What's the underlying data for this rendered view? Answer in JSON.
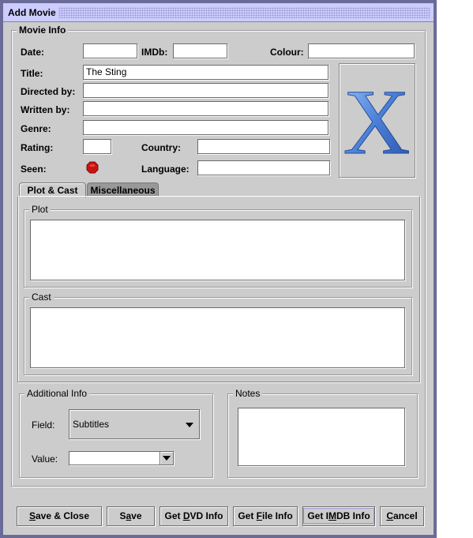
{
  "window": {
    "title": "Add Movie"
  },
  "movie_info": {
    "legend": "Movie Info",
    "date": {
      "label": "Date:",
      "value": ""
    },
    "imdb": {
      "label": "IMDb:",
      "value": ""
    },
    "colour": {
      "label": "Colour:",
      "value": ""
    },
    "title": {
      "label": "Title:",
      "value": "The Sting"
    },
    "directed_by": {
      "label": "Directed by:",
      "value": ""
    },
    "written_by": {
      "label": "Written by:",
      "value": ""
    },
    "genre": {
      "label": "Genre:",
      "value": ""
    },
    "rating": {
      "label": "Rating:",
      "value": ""
    },
    "country": {
      "label": "Country:",
      "value": ""
    },
    "seen": {
      "label": "Seen:",
      "state": "not-seen",
      "indicator_color": "#cc1111"
    },
    "language": {
      "label": "Language:",
      "value": ""
    },
    "cover": {
      "icon": "x-logo-icon",
      "glyph": "X",
      "color": "#4a7fd6"
    }
  },
  "tabs": [
    {
      "label": "Plot & Cast",
      "active": true
    },
    {
      "label": "Miscellaneous",
      "active": false
    }
  ],
  "plot": {
    "legend": "Plot",
    "value": ""
  },
  "cast": {
    "legend": "Cast",
    "value": ""
  },
  "additional_info": {
    "legend": "Additional Info",
    "field": {
      "label": "Field:",
      "selected": "Subtitles"
    },
    "value": {
      "label": "Value:",
      "selected": ""
    }
  },
  "notes": {
    "legend": "Notes",
    "value": ""
  },
  "buttons": [
    {
      "id": "save-close",
      "pre": "",
      "mn": "S",
      "post": "ave & Close"
    },
    {
      "id": "save",
      "pre": "S",
      "mn": "a",
      "post": "ve"
    },
    {
      "id": "get-dvd-info",
      "pre": "Get ",
      "mn": "D",
      "post": "VD Info"
    },
    {
      "id": "get-file-info",
      "pre": "Get ",
      "mn": "F",
      "post": "ile Info"
    },
    {
      "id": "get-imdb-info",
      "pre": "Get I",
      "mn": "M",
      "post": "DB Info"
    },
    {
      "id": "cancel",
      "pre": "",
      "mn": "C",
      "post": "ancel"
    }
  ],
  "colors": {
    "titlebar": "#ccccff",
    "frame": "#6b6b99",
    "panel": "#cccccc"
  }
}
